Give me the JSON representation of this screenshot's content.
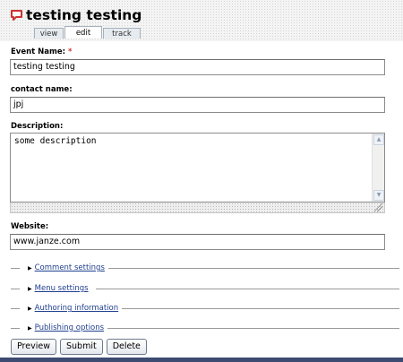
{
  "page": {
    "title": "testing testing",
    "icon": "comment-bubble-icon",
    "accent_color": "#cc3333"
  },
  "tabs": [
    {
      "label": "view",
      "active": false
    },
    {
      "label": "edit",
      "active": true
    },
    {
      "label": "track",
      "active": false
    }
  ],
  "form": {
    "event_name": {
      "label": "Event Name:",
      "required_marker": "*",
      "value": "testing testing"
    },
    "contact_name": {
      "label": "contact name:",
      "value": "jpj"
    },
    "description": {
      "label": "Description:",
      "value": "some description"
    },
    "website": {
      "label": "Website:",
      "value": "www.janze.com"
    }
  },
  "collapsible_sections": [
    {
      "label": "Comment settings"
    },
    {
      "label": "Menu settings"
    },
    {
      "label": "Authoring information"
    },
    {
      "label": "Publishing options"
    }
  ],
  "buttons": {
    "preview": "Preview",
    "submit": "Submit",
    "delete": "Delete"
  }
}
